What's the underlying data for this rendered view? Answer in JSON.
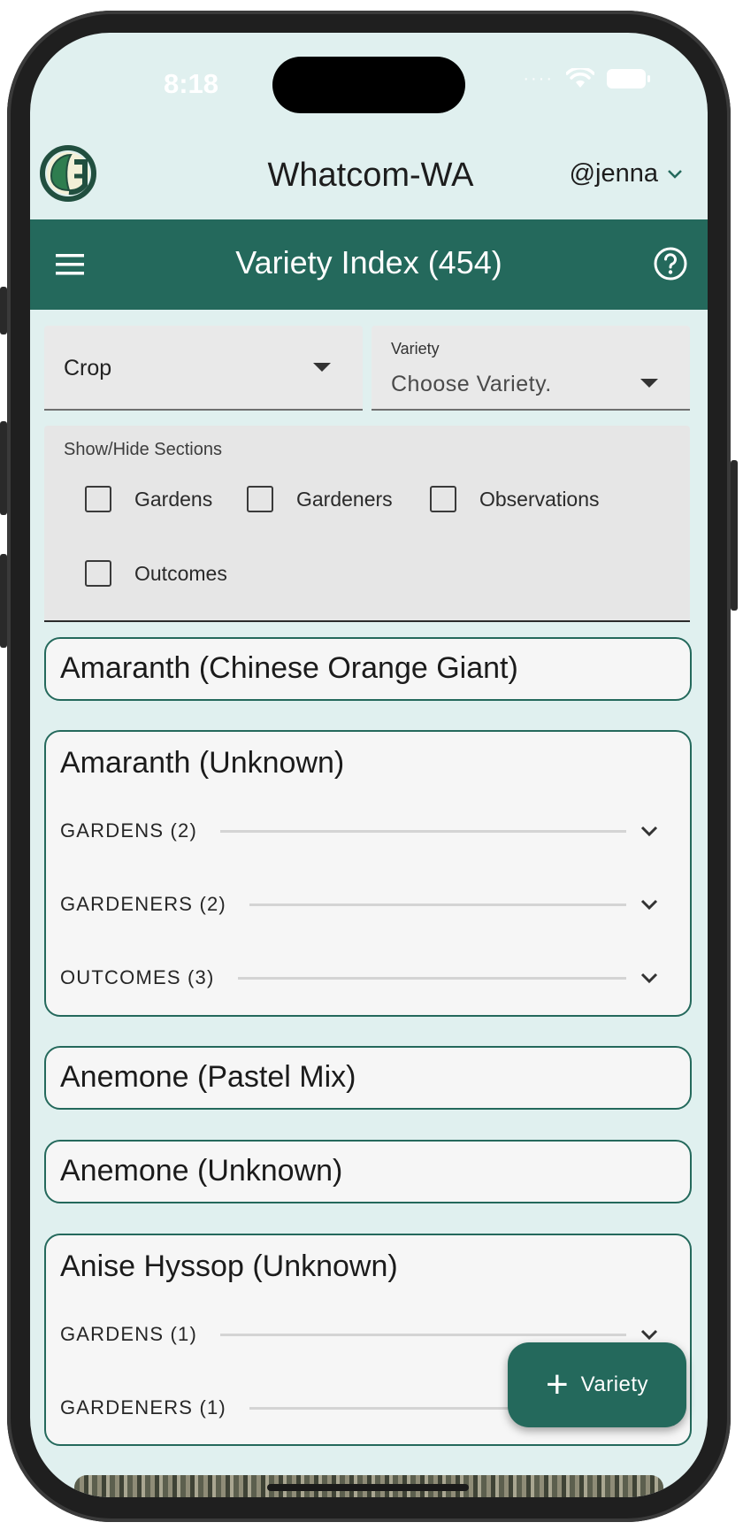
{
  "status_bar": {
    "time": "8:18"
  },
  "header": {
    "region": "Whatcom-WA",
    "user": "@jenna"
  },
  "toolbar": {
    "title": "Variety Index (454)"
  },
  "filters": {
    "crop": {
      "value": "Crop"
    },
    "variety": {
      "label": "Variety",
      "placeholder": "Choose Variety."
    }
  },
  "sections_toggle": {
    "label": "Show/Hide Sections",
    "options": [
      "Gardens",
      "Gardeners",
      "Observations",
      "Outcomes"
    ]
  },
  "cards": [
    {
      "title": "Amaranth (Chinese Orange Giant)",
      "sections": []
    },
    {
      "title": "Amaranth (Unknown)",
      "sections": [
        "GARDENS  (2)",
        "GARDENERS  (2)",
        "OUTCOMES  (3)"
      ]
    },
    {
      "title": "Anemone (Pastel Mix)",
      "sections": []
    },
    {
      "title": "Anemone (Unknown)",
      "sections": []
    },
    {
      "title": "Anise Hyssop (Unknown)",
      "sections": [
        "GARDENS  (1)",
        "GARDENERS  (1)"
      ]
    }
  ],
  "fab": {
    "label": "Variety"
  },
  "colors": {
    "primary": "#24695c",
    "background": "#e0f0ef",
    "card": "#f6f6f6"
  },
  "icons": [
    "logo-icon",
    "chevron-down-icon",
    "menu-icon",
    "help-icon",
    "dropdown-caret-icon",
    "plus-icon",
    "wifi-icon",
    "battery-icon"
  ]
}
